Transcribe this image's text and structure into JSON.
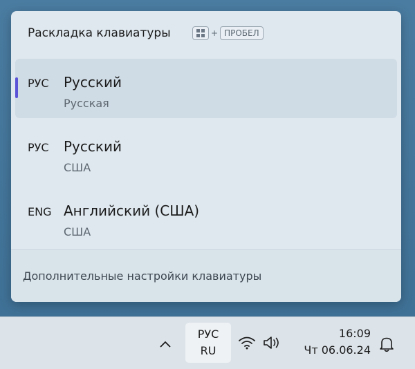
{
  "flyout": {
    "title": "Раскладка клавиатуры",
    "shortcut": {
      "win_key": "windows-key-icon",
      "plus": "+",
      "space_key": "ПРОБЕЛ"
    },
    "items": [
      {
        "code": "РУС",
        "name": "Русский",
        "layout": "Русская",
        "selected": true
      },
      {
        "code": "РУС",
        "name": "Русский",
        "layout": "США",
        "selected": false
      },
      {
        "code": "ENG",
        "name": "Английский (США)",
        "layout": "США",
        "selected": false
      }
    ],
    "footer_link": "Дополнительные настройки клавиатуры",
    "accent_color": "#5a53d8"
  },
  "taskbar": {
    "chevron": "chevron-up-icon",
    "lang_code": "РУС",
    "lang_region": "RU",
    "icons": [
      "wifi-icon",
      "volume-icon"
    ],
    "time": "16:09",
    "date": "Чт 06.06.24",
    "bell": "bell-icon"
  }
}
